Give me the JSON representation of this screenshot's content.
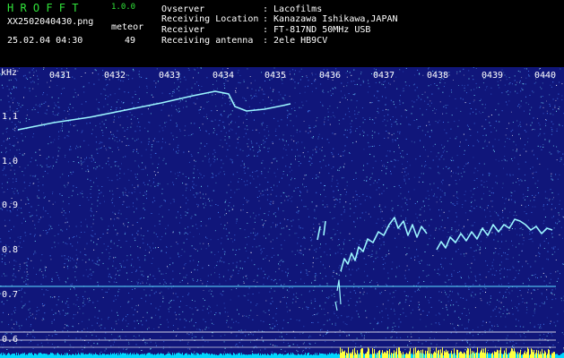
{
  "app": {
    "title": "H R O F F T",
    "version": "1.0.0",
    "filename": "XX2502040430.png",
    "datetime": "25.02.04 04:30",
    "meteor_label": "meteor",
    "meteor_count": "49"
  },
  "info": [
    {
      "key": "Ovserver",
      "value": ": Lacofilms"
    },
    {
      "key": "Receiving Location",
      "value": ": Kanazawa Ishikawa,JAPAN"
    },
    {
      "key": "Receiver",
      "value": ": FT-817ND 50MHz USB"
    },
    {
      "key": "Receiving antenna",
      "value": ": 2ele HB9CV"
    }
  ],
  "spectrogram": {
    "unit": "kHz",
    "freq_labels": [
      "1.1",
      "1.0",
      "0.9",
      "0.8",
      "0.7",
      "0.6"
    ],
    "time_labels": [
      "0431",
      "0432",
      "0433",
      "0434",
      "0435",
      "0436",
      "0437",
      "0438",
      "0439",
      "0440"
    ],
    "colors": {
      "background": "#10167a",
      "noise": "#4c8cff",
      "signal": "#7ef0ff",
      "trace": "#9cf6ff",
      "level_bar": "#00d8ff",
      "burst": "#ffff40"
    }
  }
}
